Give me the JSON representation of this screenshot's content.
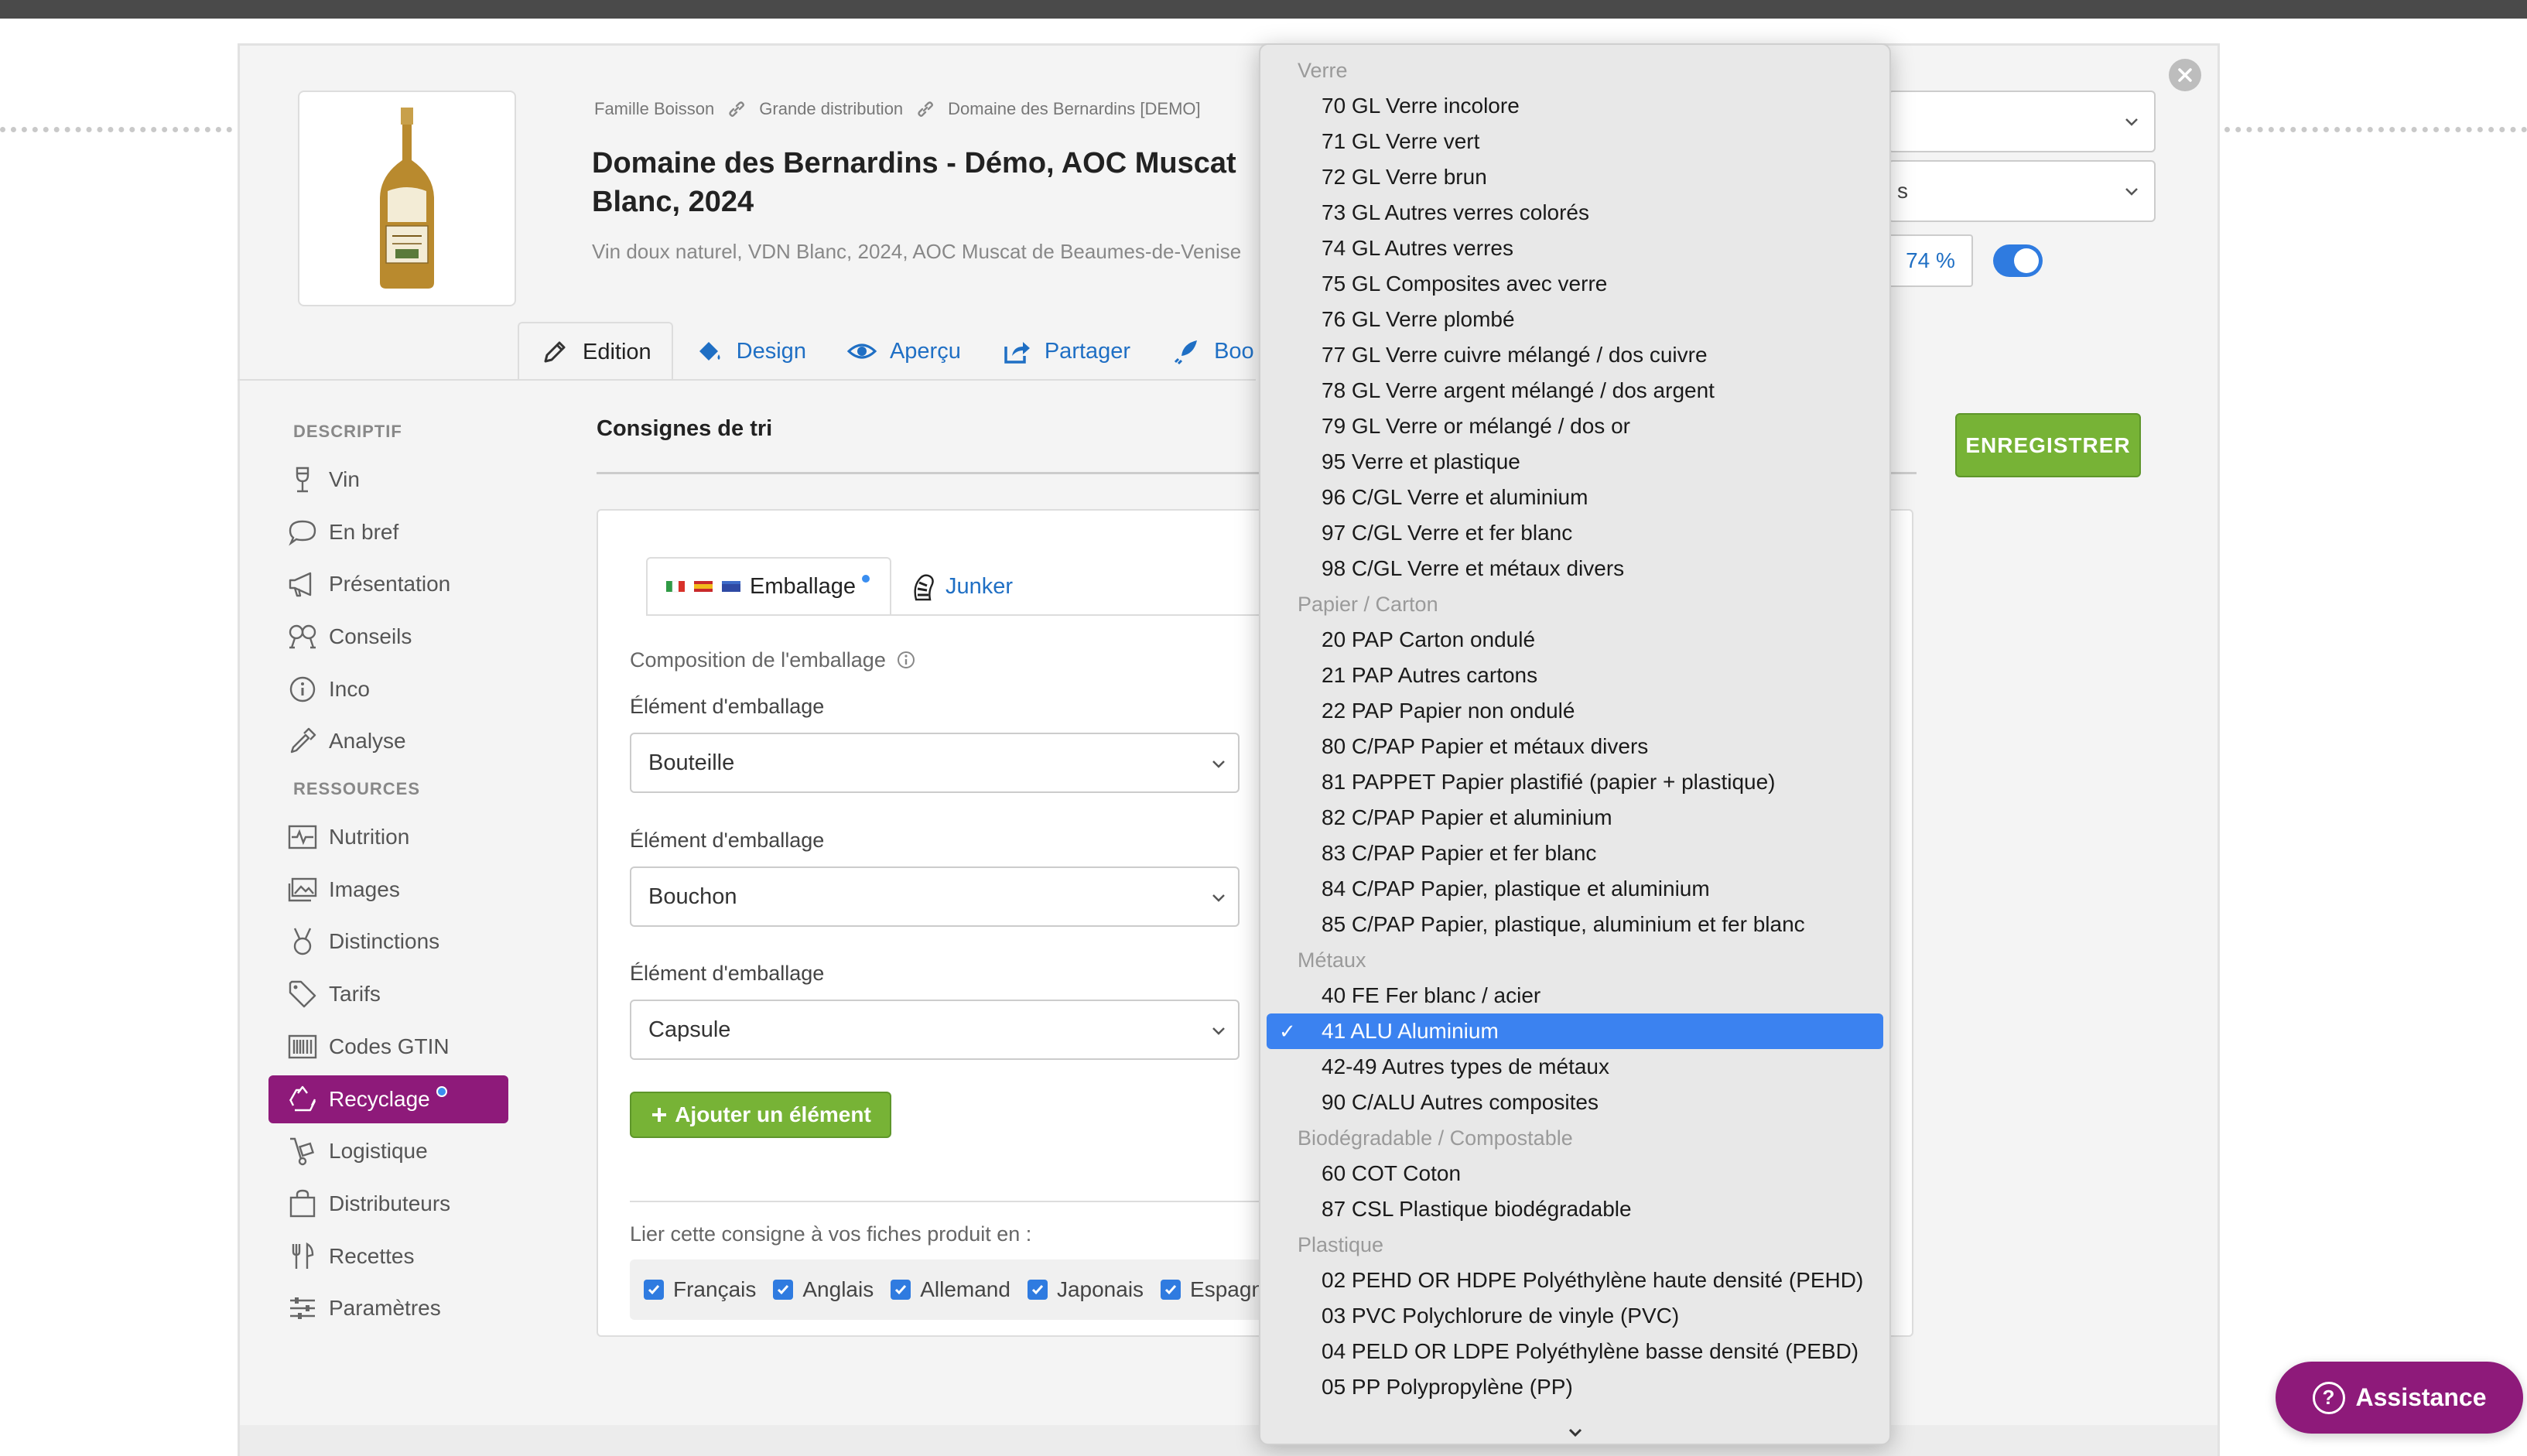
{
  "modal": {
    "breadcrumbs": [
      "Famille Boisson",
      "Grande distribution",
      "Domaine des Bernardins [DEMO]"
    ],
    "title": "Domaine des Bernardins - Démo, AOC Muscat Blanc, 2024",
    "subtitle": "Vin doux naturel, VDN Blanc, 2024, AOC Muscat de Beaumes-de-Venise",
    "tabs": [
      {
        "label": "Edition",
        "icon": "pencil-icon"
      },
      {
        "label": "Design",
        "icon": "paint-bucket-icon"
      },
      {
        "label": "Aperçu",
        "icon": "eye-icon"
      },
      {
        "label": "Partager",
        "icon": "share-icon"
      },
      {
        "label": "Boo",
        "icon": "rocket-icon"
      }
    ],
    "right_select_fragment": "s",
    "percent": "74 %",
    "save_label": "ENREGISTRER"
  },
  "sidebar": {
    "section1": "DESCRIPTIF",
    "section2": "RESSOURCES",
    "items1": [
      {
        "label": "Vin",
        "icon": "wine-glass-icon"
      },
      {
        "label": "En bref",
        "icon": "speech-bubble-icon"
      },
      {
        "label": "Présentation",
        "icon": "megaphone-icon"
      },
      {
        "label": "Conseils",
        "icon": "glasses-cheers-icon"
      },
      {
        "label": "Inco",
        "icon": "info-icon"
      },
      {
        "label": "Analyse",
        "icon": "pipette-icon"
      }
    ],
    "items2": [
      {
        "label": "Nutrition",
        "icon": "pulse-icon"
      },
      {
        "label": "Images",
        "icon": "images-icon"
      },
      {
        "label": "Distinctions",
        "icon": "medal-icon"
      },
      {
        "label": "Tarifs",
        "icon": "tag-icon"
      },
      {
        "label": "Codes GTIN",
        "icon": "barcode-icon"
      },
      {
        "label": "Recyclage",
        "icon": "recycle-icon"
      },
      {
        "label": "Logistique",
        "icon": "hand-truck-icon"
      },
      {
        "label": "Distributeurs",
        "icon": "shopping-bag-icon"
      },
      {
        "label": "Recettes",
        "icon": "utensils-icon"
      },
      {
        "label": "Paramètres",
        "icon": "sliders-icon"
      }
    ]
  },
  "content": {
    "section_title": "Consignes de tri",
    "subtab_emballage": "Emballage",
    "subtab_junker": "Junker",
    "composition_label": "Composition de l'emballage",
    "element_label": "Élément d'emballage",
    "elements": [
      "Bouteille",
      "Bouchon",
      "Capsule"
    ],
    "add_label": "Ajouter un élément",
    "link_label": "Lier cette consigne à vos fiches produit en :",
    "languages": [
      "Français",
      "Anglais",
      "Allemand",
      "Japonais",
      "Espagnol"
    ]
  },
  "dropdown": {
    "groups": [
      {
        "name": "Verre",
        "options": [
          "70 GL Verre incolore",
          "71 GL Verre vert",
          "72 GL Verre brun",
          "73 GL Autres verres colorés",
          "74 GL Autres verres",
          "75 GL Composites avec verre",
          "76 GL Verre plombé",
          "77 GL Verre cuivre mélangé / dos cuivre",
          "78 GL Verre argent mélangé / dos argent",
          "79 GL Verre or mélangé / dos or",
          "95 Verre et plastique",
          "96 C/GL Verre et aluminium",
          "97 C/GL Verre et fer blanc",
          "98 C/GL Verre et métaux divers"
        ]
      },
      {
        "name": "Papier / Carton",
        "options": [
          "20 PAP Carton ondulé",
          "21 PAP Autres cartons",
          "22 PAP Papier non ondulé",
          "80 C/PAP Papier et métaux divers",
          "81 PAPPET Papier plastifié (papier + plastique)",
          "82 C/PAP Papier et aluminium",
          "83 C/PAP Papier et fer blanc",
          "84 C/PAP Papier, plastique et aluminium",
          "85 C/PAP Papier, plastique, aluminium et fer blanc"
        ]
      },
      {
        "name": "Métaux",
        "options": [
          "40 FE Fer blanc / acier",
          "41 ALU Aluminium",
          "42-49 Autres types de métaux",
          "90 C/ALU Autres composites"
        ]
      },
      {
        "name": "Biodégradable / Compostable",
        "options": [
          "60 COT Coton",
          "87 CSL Plastique biodégradable"
        ]
      },
      {
        "name": "Plastique",
        "options": [
          "02 PEHD OR HDPE Polyéthylène haute densité (PEHD)",
          "03 PVC Polychlorure de vinyle (PVC)",
          "04 PELD OR LDPE Polyéthylène basse densité (PEBD)",
          "05 PP Polypropylène (PP)"
        ]
      }
    ],
    "selected": "41 ALU Aluminium"
  },
  "assistance": {
    "label": "Assistance"
  },
  "colors": {
    "accent": "#8e1a7a",
    "green": "#77b336",
    "blue": "#3b82f0",
    "link": "#1f6fc4"
  }
}
